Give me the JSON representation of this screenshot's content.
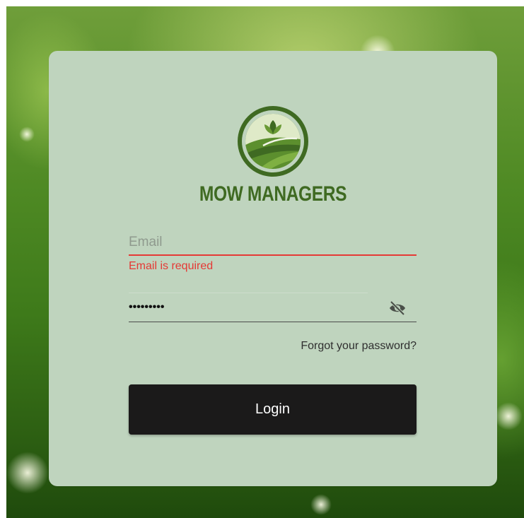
{
  "brand": {
    "name": "MOW MANAGERS",
    "color": "#3f6a22"
  },
  "form": {
    "email": {
      "placeholder": "Email",
      "value": "",
      "error": "Email is required"
    },
    "password": {
      "masked_value": "•••••••••"
    },
    "forgot_label": "Forgot your password?",
    "login_label": "Login"
  },
  "colors": {
    "card": "#bfd4be",
    "error": "#e53935",
    "button": "#1b1a1a"
  }
}
